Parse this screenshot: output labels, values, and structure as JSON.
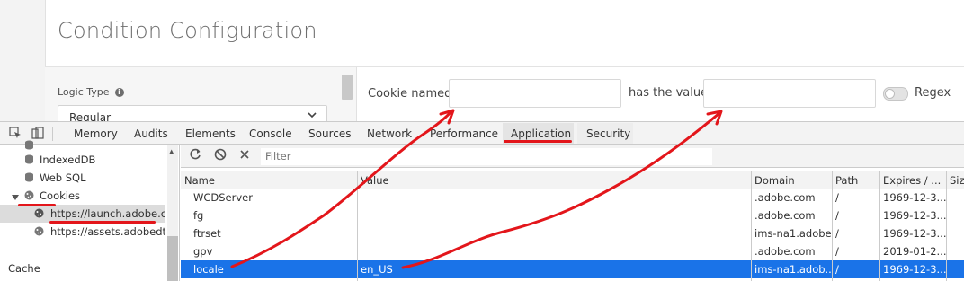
{
  "app": {
    "title": "Condition Configuration",
    "logic_type_label": "Logic Type",
    "logic_type_value": "Regular",
    "cookie_named_label": "Cookie named",
    "cookie_named_value": "",
    "has_value_label": "has the value",
    "has_value_value": "",
    "regex_label": "Regex",
    "regex_on": false
  },
  "devtools": {
    "tabs": [
      "Memory",
      "Audits",
      "Elements",
      "Console",
      "Sources",
      "Network",
      "Performance",
      "Application",
      "Security"
    ],
    "active_tab": "Application",
    "sidebar": {
      "items": [
        {
          "label": "IndexedDB",
          "icon": "database-icon"
        },
        {
          "label": "Web SQL",
          "icon": "database-icon"
        },
        {
          "label": "Cookies",
          "icon": "cookie-icon",
          "expanded": true
        },
        {
          "label": "https://launch.adobe.com",
          "icon": "cookie-icon",
          "selected": true
        },
        {
          "label": "https://assets.adobedtm.com",
          "icon": "cookie-icon"
        }
      ],
      "cache_label": "Cache"
    },
    "toolbar": {
      "filter_placeholder": "Filter"
    },
    "table": {
      "headers": [
        "Name",
        "Value",
        "Domain",
        "Path",
        "Expires / ...",
        "Size"
      ],
      "rows": [
        {
          "name": "WCDServer",
          "value": "",
          "domain": ".adobe.com",
          "path": "/",
          "expires": "1969-12-3..."
        },
        {
          "name": "fg",
          "value": "",
          "domain": ".adobe.com",
          "path": "/",
          "expires": "1969-12-3..."
        },
        {
          "name": "ftrset",
          "value": "",
          "domain": "ims-na1.adobe...",
          "path": "/",
          "expires": "1969-12-3..."
        },
        {
          "name": "gpv",
          "value": "",
          "domain": ".adobe.com",
          "path": "/",
          "expires": "2019-01-2..."
        },
        {
          "name": "locale",
          "value": "en_US",
          "domain": "ims-na1.adob...",
          "path": "/",
          "expires": "1969-12-3...",
          "selected": true
        }
      ]
    }
  },
  "colors": {
    "annotation": "#e3161b",
    "selection": "#1a73e8"
  }
}
